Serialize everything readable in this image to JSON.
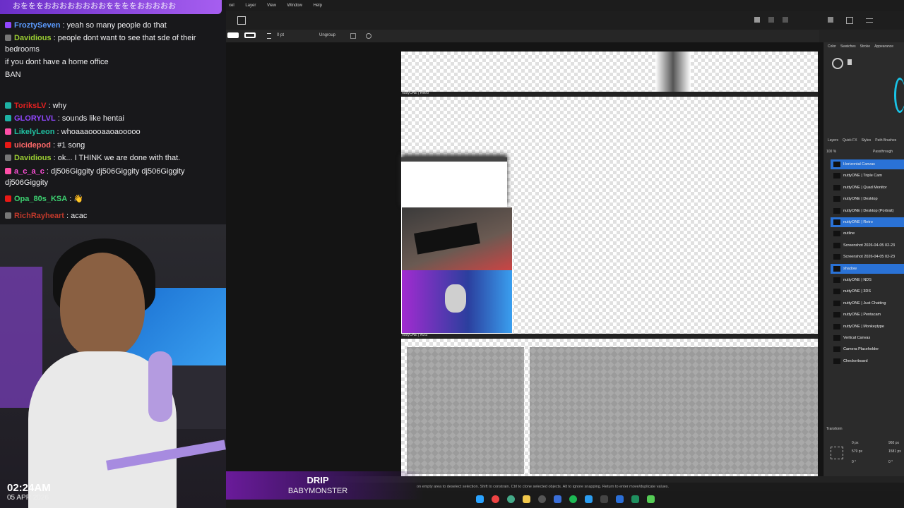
{
  "chat": {
    "banner": "おをををおおおおおおおおををををおおおおお",
    "messages": [
      {
        "user": "FroztySeven",
        "color": "#5b9bff",
        "badge": "b-purple",
        "text": " : yeah so many people do that"
      },
      {
        "user": "Davidious",
        "color": "#9acd32",
        "badge": "b-gray",
        "text": " : people dont want to see that sde of their bedrooms"
      },
      {
        "user": "",
        "color": "#fff",
        "badge": "",
        "text": "if you dont have a home office"
      },
      {
        "user": "",
        "color": "#fff",
        "badge": "",
        "text": "BAN"
      },
      {
        "user": "ToriksLV",
        "color": "#e02020",
        "badge": "b-teal",
        "text": " : why"
      },
      {
        "user": "GLORYLVL",
        "color": "#9147ff",
        "badge": "b-teal",
        "text": " : sounds like hentai"
      },
      {
        "user": "LikelyLeon",
        "color": "#20c0a0",
        "badge": "b-pink",
        "text": " : whoaaaoooaaoaooooo"
      },
      {
        "user": "uicidepod",
        "color": "#ff6a6a",
        "badge": "b-red",
        "text": " : #1 song"
      },
      {
        "user": "Davidious",
        "color": "#9acd32",
        "badge": "b-gray",
        "text": " : ok... I THINK we are done with that."
      },
      {
        "user": "a_c_a_c",
        "color": "#ff4fd8",
        "badge": "b-pink",
        "text": " : dj506Giggity dj506Giggity dj506Giggity dj506Giggity"
      },
      {
        "user": "Opa_80s_KSA",
        "color": "#3cd070",
        "badge": "b-red",
        "text": " : 👋"
      },
      {
        "user": "RichRayheart",
        "color": "#c0392b",
        "badge": "b-gray",
        "text": " : acac"
      }
    ]
  },
  "overlay": {
    "clock": "02:24AM",
    "date": "05 APR 2026",
    "music_title": "DRIP",
    "music_artist": "BABYMONSTER"
  },
  "menu": [
    "xel",
    "Layer",
    "View",
    "Window",
    "Help"
  ],
  "toolbar": {
    "stroke_size": "0 pt",
    "ungroup": "Ungroup"
  },
  "canvas_labels": {
    "retro": "nuttyONE | Retro",
    "nds": "nuttyONE | NDS"
  },
  "panel": {
    "top_tabs": [
      "Color",
      "Swatches",
      "Stroke",
      "Appearance"
    ],
    "layer_tabs": [
      "Layers",
      "Quick FX",
      "Styles",
      "Path Brushes"
    ],
    "opacity": "100 %",
    "blend": "Passthrough",
    "layers": [
      {
        "name": "Horizontal Canvas",
        "selected": true
      },
      {
        "name": "nuttyONE | Triple Cam",
        "selected": false
      },
      {
        "name": "nuttyONE | Quad Monitor",
        "selected": false
      },
      {
        "name": "nuttyONE | Desktop",
        "selected": false
      },
      {
        "name": "nuttyONE | Desktop (Portrait)",
        "selected": false
      },
      {
        "name": "nuttyONE | Retro",
        "selected": true
      },
      {
        "name": "outline",
        "selected": false
      },
      {
        "name": "Screenshot 2026-04-05 02-23",
        "selected": false
      },
      {
        "name": "Screenshot 2026-04-05 02-23",
        "selected": false
      },
      {
        "name": "shadow",
        "selected": true
      },
      {
        "name": "nuttyONE | NDS",
        "selected": false
      },
      {
        "name": "nuttyONE | 3DS",
        "selected": false
      },
      {
        "name": "nuttyONE | Just Chatting",
        "selected": false
      },
      {
        "name": "nuttyONE | Pentacam",
        "selected": false
      },
      {
        "name": "nuttyONE | Monkeytype",
        "selected": false
      },
      {
        "name": "Vertical Canvas",
        "selected": false
      },
      {
        "name": "Camera Placeholder",
        "selected": false
      },
      {
        "name": "Checkerboard",
        "selected": false
      }
    ],
    "transform_label": "Transform",
    "transform": {
      "x": "0 px",
      "y": "579 px",
      "w": "960 px",
      "h": "1581 px",
      "r": "0 °",
      "s": "0 °"
    }
  },
  "statusbar": "on empty area to deselect selection. Shift to constrain. Ctrl to clone selected objects. Alt to ignore snapping. Return to enter move/duplicate values."
}
